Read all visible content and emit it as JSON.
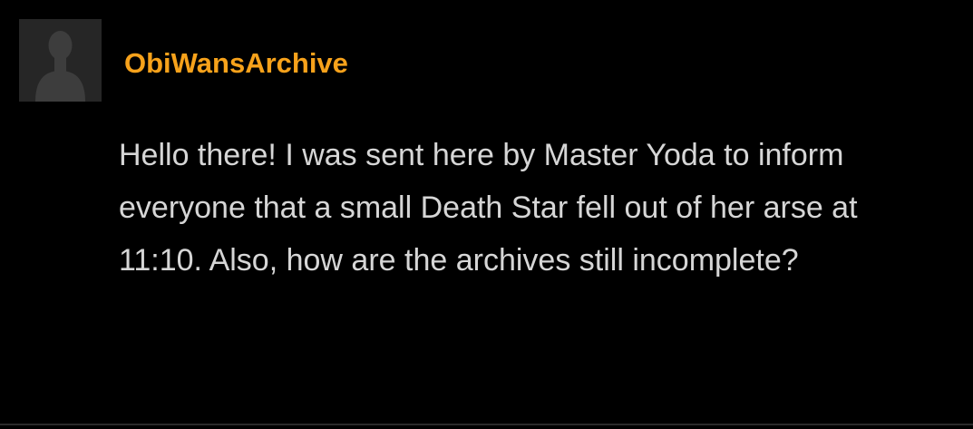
{
  "comment": {
    "author": {
      "username": "ObiWansArchive",
      "avatar_icon": "default-user-silhouette-icon",
      "username_color": "#f7a21b"
    },
    "body": "Hello there! I was sent here by Master Yoda to inform everyone that a small Death Star fell out of her arse at 11:10. Also, how are the archives still incomplete?",
    "text_color": "#d6d6d6",
    "background_color": "#000000"
  }
}
